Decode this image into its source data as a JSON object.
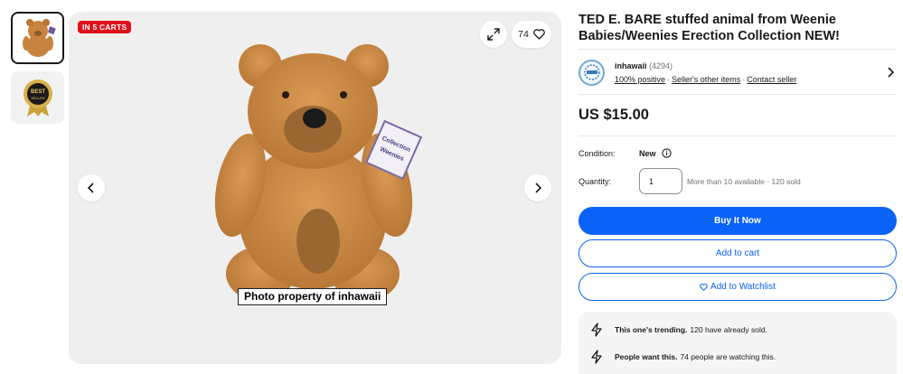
{
  "gallery": {
    "badge": "IN 5 CARTS",
    "watch_count": "74",
    "watermark": "Photo property of inhawaii"
  },
  "listing": {
    "title": "TED E. BARE stuffed animal from Weenie Babies/Weenies Erection Collection NEW!",
    "price": "US $15.00"
  },
  "seller": {
    "name": "inhawaii",
    "feedback": "(4294)",
    "positive": "100% positive",
    "other_items": "Seller's other items",
    "contact": "Contact seller"
  },
  "details": {
    "condition_label": "Condition:",
    "condition_value": "New",
    "quantity_label": "Quantity:",
    "quantity_value": "1",
    "availability": "More than 10 available · 120 sold"
  },
  "actions": {
    "buy": "Buy It Now",
    "cart": "Add to cart",
    "watch": "Add to Watchlist"
  },
  "signals": [
    {
      "bold": "This one's trending.",
      "text": "120 have already sold."
    },
    {
      "bold": "People want this.",
      "text": "74 people are watching this."
    }
  ],
  "colors": {
    "primary": "#0b62f6",
    "badge": "#e0101c"
  }
}
